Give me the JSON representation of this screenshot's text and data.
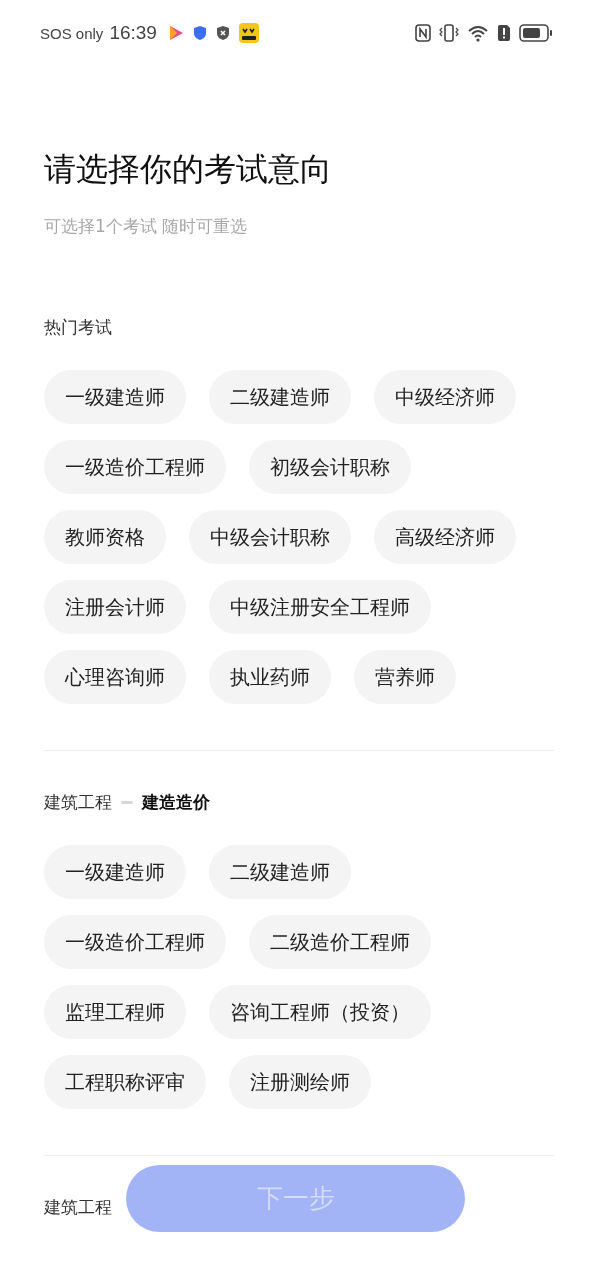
{
  "status_bar": {
    "carrier": "SOS only",
    "time": "16:39"
  },
  "header": {
    "title": "请选择你的考试意向",
    "subtitle": "可选择1个考试 随时可重选"
  },
  "sections": [
    {
      "label": "热门考试",
      "chips": [
        {
          "label": "一级建造师",
          "selected": false
        },
        {
          "label": "二级建造师",
          "selected": false
        },
        {
          "label": "中级经济师",
          "selected": false
        },
        {
          "label": "一级造价工程师",
          "selected": false
        },
        {
          "label": "初级会计职称",
          "selected": false
        },
        {
          "label": "教师资格",
          "selected": false
        },
        {
          "label": "中级会计职称",
          "selected": false
        },
        {
          "label": "高级经济师",
          "selected": false
        },
        {
          "label": "注册会计师",
          "selected": false
        },
        {
          "label": "中级注册安全工程师",
          "selected": false
        },
        {
          "label": "心理咨询师",
          "selected": false
        },
        {
          "label": "执业药师",
          "selected": false
        },
        {
          "label": "营养师",
          "selected": false
        }
      ]
    },
    {
      "label": "建筑工程",
      "sublabel": "建造造价",
      "chips": [
        {
          "label": "一级建造师",
          "selected": false
        },
        {
          "label": "二级建造师",
          "selected": false
        },
        {
          "label": "一级造价工程师",
          "selected": false
        },
        {
          "label": "二级造价工程师",
          "selected": false
        },
        {
          "label": "监理工程师",
          "selected": false
        },
        {
          "label": "咨询工程师（投资）",
          "selected": false
        },
        {
          "label": "工程职称评审",
          "selected": false
        },
        {
          "label": "注册测绘师",
          "selected": false
        }
      ]
    },
    {
      "label": "建筑工程"
    }
  ],
  "next_button": {
    "label": "下一步",
    "disabled": true
  }
}
